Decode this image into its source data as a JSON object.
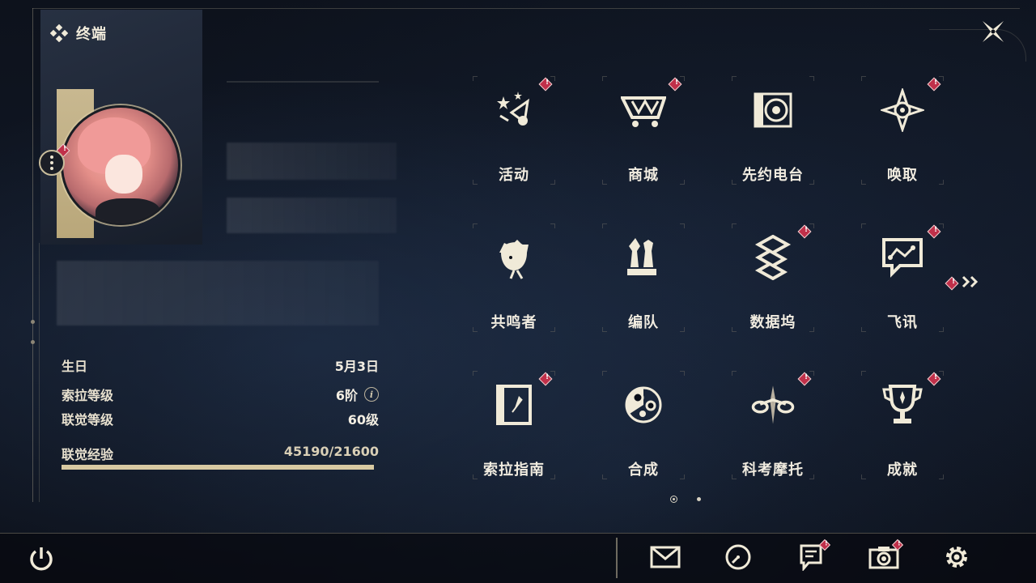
{
  "header": {
    "title": "终端",
    "logo_icon": "diamond-cluster-icon"
  },
  "close_button": {
    "icon": "close-x-icon"
  },
  "profile": {
    "more_icon": "more-vertical-icon",
    "birthday_label": "生日",
    "birthday_value": "5月3日",
    "sola_level_label": "索拉等级",
    "sola_level_value": "6阶",
    "sync_level_label": "联觉等级",
    "sync_level_value": "60级",
    "sync_exp_label": "联觉经验",
    "sync_exp_value": "45190/21600",
    "sync_exp_progress": 1.0
  },
  "menu": {
    "tiles": [
      {
        "label": "活动",
        "icon": "activity-stars-icon",
        "alert": true
      },
      {
        "label": "商城",
        "icon": "shop-cart-icon",
        "alert": true
      },
      {
        "label": "先约电台",
        "icon": "radio-disc-icon",
        "alert": false
      },
      {
        "label": "唤取",
        "icon": "convene-star-icon",
        "alert": true
      },
      {
        "label": "共鸣者",
        "icon": "resonator-portrait-icon",
        "alert": false
      },
      {
        "label": "编队",
        "icon": "team-chess-icon",
        "alert": false
      },
      {
        "label": "数据坞",
        "icon": "data-bank-icon",
        "alert": true
      },
      {
        "label": "飞讯",
        "icon": "message-bubble-icon",
        "alert": true
      },
      {
        "label": "索拉指南",
        "icon": "guidebook-icon",
        "alert": true
      },
      {
        "label": "合成",
        "icon": "synthesis-icon",
        "alert": false
      },
      {
        "label": "科考摩托",
        "icon": "motorbike-icon",
        "alert": true
      },
      {
        "label": "成就",
        "icon": "trophy-icon",
        "alert": true
      }
    ],
    "next_page_icon": "double-chevron-right-icon",
    "pages": 2,
    "current_page": 1
  },
  "bottom_bar": {
    "power_icon": "power-icon",
    "items": [
      {
        "icon": "mail-icon",
        "alert": false
      },
      {
        "icon": "clock-icon",
        "alert": false
      },
      {
        "icon": "notice-icon",
        "alert": true
      },
      {
        "icon": "camera-icon",
        "alert": true
      },
      {
        "icon": "settings-gear-icon",
        "alert": false
      }
    ]
  },
  "colors": {
    "accent_gold": "#d8c9a2",
    "alert_red": "#c0304a",
    "text_primary": "#f1ece0"
  }
}
